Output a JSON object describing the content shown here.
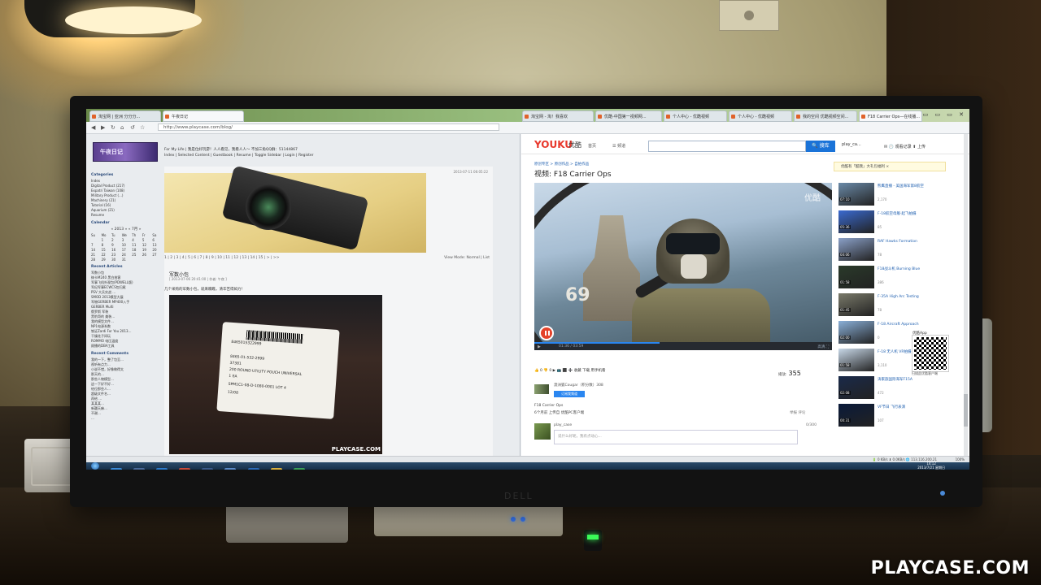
{
  "browser": {
    "tabs": [
      {
        "label": "淘宝网 | 亚洲 分分分..."
      },
      {
        "label": "午夜日记"
      },
      {
        "label": "淘宝网 - 淘！我喜欢"
      },
      {
        "label": "优酷-中国第一视频网..."
      },
      {
        "label": "个人中心 - 优酷视频"
      },
      {
        "label": "个人中心 - 优酷视频"
      },
      {
        "label": "我的空间 优酷视频空间..."
      },
      {
        "label": "F18 Carrier Ops—在线播..."
      }
    ],
    "address": "http://www.playcase.com/blog/"
  },
  "blog": {
    "logo_text": "午夜日记",
    "tagline": "For My Life | 我是位好玩游！人人看见，我看人人～ 不加三角QQ群：51144867",
    "nav": "Index | Selected Content | Guestbook | Resume | Toggle Sidebar | Login | Register",
    "sidebar": {
      "categories_heading": "Categories",
      "categories": [
        "Index",
        "Digital Product (217)",
        "Expatri Taiwan (108)",
        "Military Product (...)",
        "Machinery (21)",
        "Tutorial (16)",
        "Aquarium (21)",
        "Resume"
      ],
      "calendar_heading": "Calendar",
      "calendar_title": "« 2013 » « 7月 »",
      "calendar_days": [
        "Su",
        "Mo",
        "Tu",
        "We",
        "Th",
        "Fr",
        "Sa",
        "",
        "1",
        "2",
        "3",
        "4",
        "5",
        "6",
        "7",
        "8",
        "9",
        "10",
        "11",
        "12",
        "13",
        "14",
        "15",
        "16",
        "17",
        "18",
        "19",
        "20",
        "21",
        "22",
        "23",
        "24",
        "25",
        "26",
        "27",
        "28",
        "29",
        "30",
        "31",
        "",
        "",
        ""
      ],
      "recent_articles_heading": "Recent Articles",
      "recent_articles": [
        "军数小包",
        "徕卡M240 黑白拍客",
        "军事飞机外观包(PDWELL版)",
        "军纪军事ECWCS包扫尾",
        "PSV 大兵实战 …",
        "SMOD 2013模型大展",
        "军物GERBER MP400入手",
        "GERBER Multi",
        "俄罗斯 军装",
        "黑豹哥的 美装…",
        "我的模型文件…",
        "NP1电源系数",
        "铁证Zardi For You 2013…",
        "干燥花子间玩",
        "ROMMO 电压温度",
        "顾播的DBA工具"
      ],
      "recent_comments_heading": "Recent Comments",
      "recent_comments": [
        "我的一下，整了包至…",
        "视听有点力...",
        "小说不错，好像做得太",
        "那天的…",
        "那些人物模型…",
        "这一下好不好…",
        "给位那些人…",
        "超级文件名…",
        "再给 …",
        "某某某…",
        "新疆天麻…",
        "不谢…",
        "…"
      ]
    },
    "post": {
      "date": "2013-07-11 06:05:22",
      "pager": "1 | 2 | 3 | 4 | 5 | 6 | 7 | 8 | 9 | 10 | 11 | 12 | 13 | 14 | 15 | > | >>",
      "view_mode": "View Mode: Normal | List",
      "title": "军数小包",
      "meta": "[ 2013-07-06 20:41:00 | 作者: 午夜 ]",
      "text": "几个采购的军数小包，就来瞧瞧，清华苦得如力！",
      "label_lines": [
        "8465015322999",
        "8465-01-532-2999",
        "37381",
        "200 ROUND UTILITY POUCH UNIVERSAL",
        "1 EA",
        "SPM1C1-08-D-1080-0001   LOT 4",
        "12/08"
      ],
      "watermark": "PLAYCASE.COM"
    }
  },
  "youku": {
    "logo": "YOUKU",
    "logo_cn": "优酷",
    "nav_home": "首页",
    "nav_channels": "☰ 频道",
    "search_button": "🔍 搜库",
    "user": "play_ca...",
    "right_links": "✉  🕐 观看记录  ⬆ 上传",
    "breadcrumbs": "原创专区 > 原创作品 > 自拍作品",
    "video_title": "视频: F18 Carrier Ops",
    "notice": "优酷有「酷我」大礼包福利 ×",
    "video_watermark": "优酷",
    "deck_number": "69",
    "time": "01:36 / 03:59",
    "progress": 0.42,
    "controls_right": "高清  ⛶",
    "actions": "👍 0  👎 0  ▶ 📺 ⬛ ➕ 收藏  下载  用手机看",
    "views_label": "播放:",
    "views_count": "355",
    "uploader": "澳洲狐Cougar（积分数）308",
    "subscribe": "订阅我频道",
    "desc_title": "F18 Carrier Ops",
    "desc_meta": "6个月前 上传自 优酷PC客户端",
    "desc_right": "举报   评论",
    "comment_user": "play_case",
    "comment_placeholder": "说什么好呢，我有点动心...",
    "comment_count": "0/300",
    "related": [
      {
        "duration": "07:10",
        "title": "熊鹰直播 - 美国海军第8航空",
        "plays": "2,170"
      },
      {
        "duration": "05:36",
        "title": "F-18航空母舰-起飞拍摄",
        "plays": "85"
      },
      {
        "duration": "04:06",
        "title": "RAF Hawks Formation",
        "plays": "78"
      },
      {
        "duration": "01:58",
        "title": "F18战斗机 Burning Blue",
        "plays": "386"
      },
      {
        "duration": "01:45",
        "title": "F-35A High Arc Testing",
        "plays": "78"
      },
      {
        "duration": "02:00",
        "title": "F-18 Aircraft Approach",
        "plays": "0"
      },
      {
        "duration": "01:58",
        "title": "F-18 无人机 VR拍摄",
        "plays": "3,110"
      },
      {
        "duration": "02:08",
        "title": "涛家族国际海军F15A",
        "plays": "472"
      },
      {
        "duration": "00:31",
        "title": "VF节日 飞行表演",
        "plays": "107"
      }
    ],
    "qr_title": "优酷App",
    "qr_caption": "扫描此优酷客户端"
  },
  "status": {
    "right": "🔋 0 KB/s  ⬇ 0.0KB/s  🌐 113.116.200.21",
    "zoom": "100%"
  },
  "taskbar": {
    "time": "14:12",
    "date": "2013/7/21 星期日"
  },
  "monitor_brand": "DELL",
  "photo_watermark": "PLAYCASE.COM"
}
